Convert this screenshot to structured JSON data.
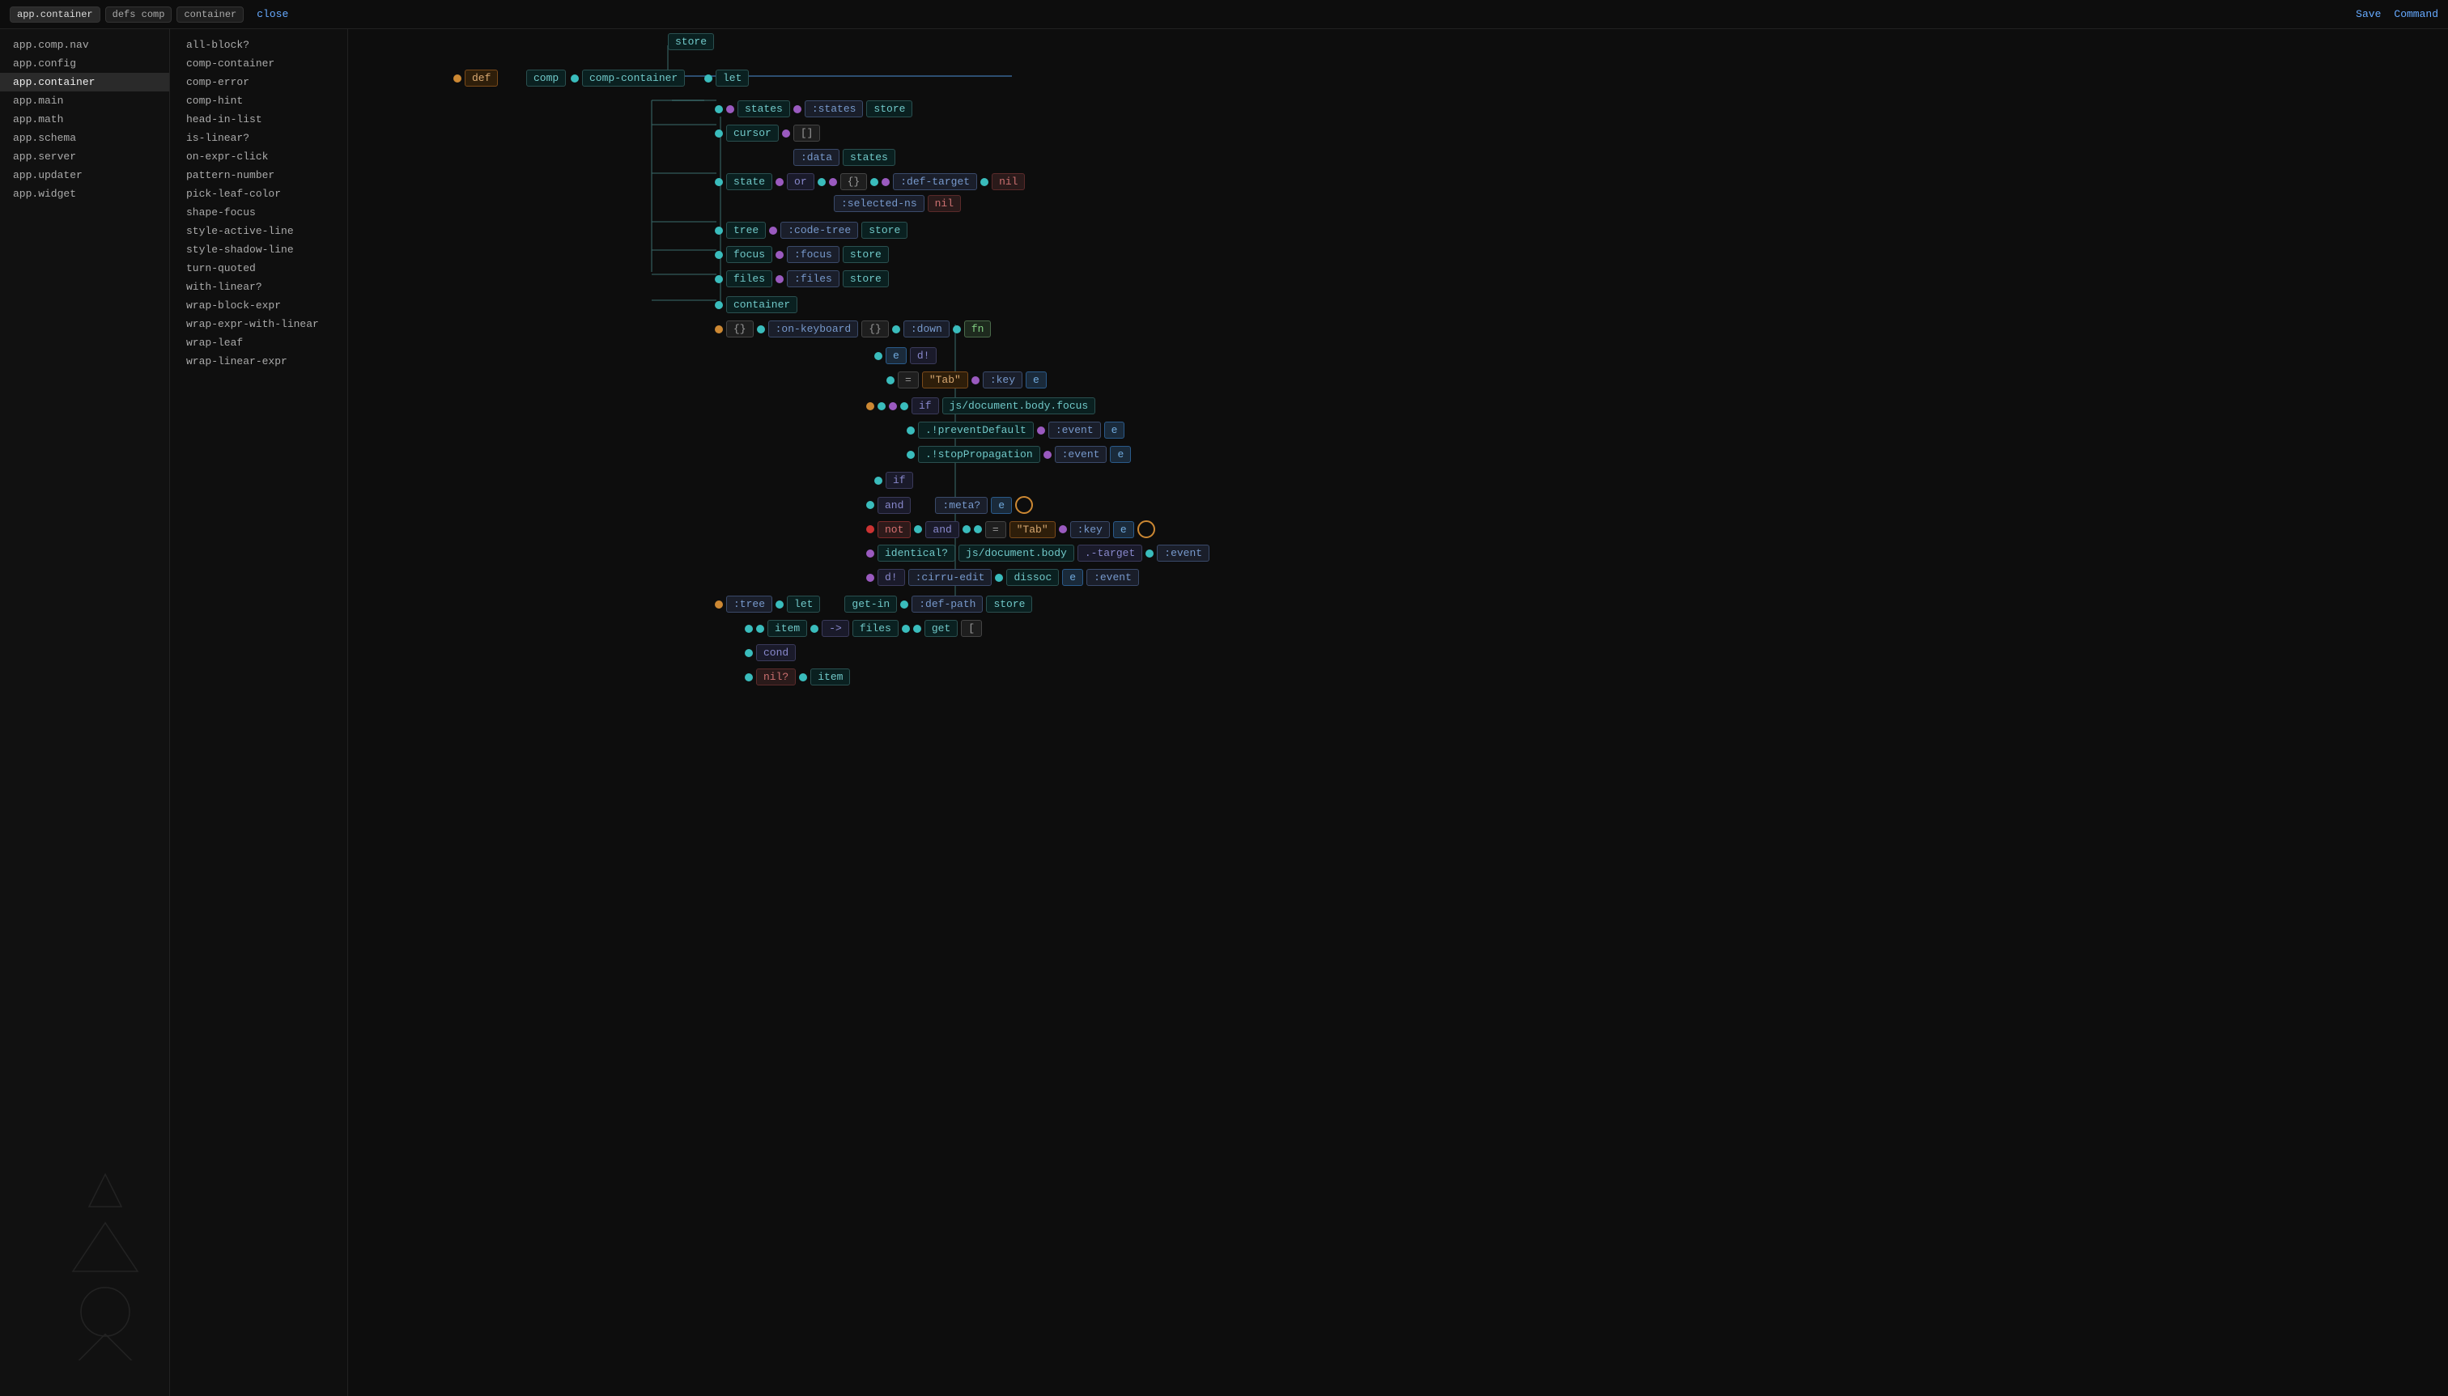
{
  "topbar": {
    "tabs": [
      {
        "label": "app.container",
        "active": true
      },
      {
        "label": "defs comp",
        "active": false
      },
      {
        "label": "container",
        "active": false
      }
    ],
    "close_label": "close",
    "save_label": "Save",
    "command_label": "Command"
  },
  "sidebar": {
    "items": [
      {
        "label": "app.comp.nav",
        "active": false
      },
      {
        "label": "app.config",
        "active": false
      },
      {
        "label": "app.container",
        "active": true
      },
      {
        "label": "app.main",
        "active": false
      },
      {
        "label": "app.math",
        "active": false
      },
      {
        "label": "app.schema",
        "active": false
      },
      {
        "label": "app.server",
        "active": false
      },
      {
        "label": "app.updater",
        "active": false
      },
      {
        "label": "app.widget",
        "active": false
      }
    ]
  },
  "defs": {
    "items": [
      {
        "label": "all-block?"
      },
      {
        "label": "comp-container"
      },
      {
        "label": "comp-error"
      },
      {
        "label": "comp-hint"
      },
      {
        "label": "head-in-list"
      },
      {
        "label": "is-linear?"
      },
      {
        "label": "on-expr-click"
      },
      {
        "label": "pattern-number"
      },
      {
        "label": "pick-leaf-color"
      },
      {
        "label": "shape-focus"
      },
      {
        "label": "style-active-line"
      },
      {
        "label": "style-shadow-line"
      },
      {
        "label": "turn-quoted"
      },
      {
        "label": "with-linear?"
      },
      {
        "label": "wrap-block-expr"
      },
      {
        "label": "wrap-expr-with-linear"
      },
      {
        "label": "wrap-leaf"
      },
      {
        "label": "wrap-linear-expr"
      }
    ]
  },
  "graph": {
    "nodes": {
      "store": "store",
      "def": "def",
      "comp": "comp",
      "comp_container": "comp-container",
      "let": "let",
      "states": "states",
      "states_kw": ":states",
      "store1": "store",
      "cursor": "cursor",
      "bracket": "[]",
      "data_kw": ":data",
      "states2": "states",
      "state": "state",
      "or": "or",
      "empty_map": "{}",
      "def_target": ":def-target",
      "nil1": "nil",
      "selected_ns": ":selected-ns",
      "nil2": "nil",
      "tree": "tree",
      "code_tree": ":code-tree",
      "store2": "store",
      "focus": "focus",
      "focus_kw": ":focus",
      "store3": "store",
      "files": "files",
      "files_kw": ":files",
      "store4": "store",
      "container": "container",
      "empty_map2": "{}",
      "on_keyboard": ":on-keyboard",
      "empty_map3": "{}",
      "down": ":down",
      "fn": "fn",
      "e": "e",
      "d_bang": "d!",
      "eq": "=",
      "tab_str": "\"Tab\"",
      "key_kw": ":key",
      "e2": "e",
      "if1": "if",
      "js_focus": "js/document.body.focus",
      "prevent_default": ".!preventDefault",
      "event_kw1": ":event",
      "e3": "e",
      "stop_prop": ".!stopPropagation",
      "event_kw2": ":event",
      "e4": "e",
      "if2": "if",
      "and1": "and",
      "meta_q": ":meta?",
      "e5": "e",
      "not": "not",
      "and2": "and",
      "eq2": "=",
      "tab_str2": "\"Tab\"",
      "key_kw2": ":key",
      "e6": "e",
      "identical_q": "identical?",
      "js_body": "js/document.body",
      "dot_target": ".-target",
      "event_kw3": ":event",
      "d_bang2": "d!",
      "cirru_edit": ":cirru-edit",
      "dissoc": "dissoc",
      "e7": "e",
      "event_kw4": ":event",
      "tree_kw": ":tree",
      "let2": "let",
      "get_in": "get-in",
      "def_path": ":def-path",
      "store5": "store",
      "item": "item",
      "arrow": "->",
      "files2": "files",
      "get": "get",
      "bracket2": "[",
      "cond": "cond",
      "nil_q": "nil?",
      "item2": "item"
    }
  }
}
